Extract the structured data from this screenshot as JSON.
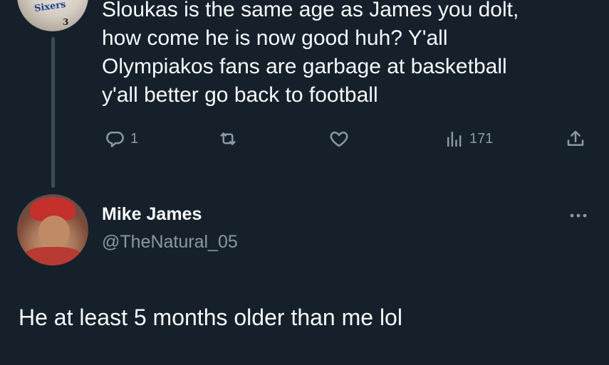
{
  "parent_tweet": {
    "avatar_icon": "user-avatar-icon",
    "avatar_jersey_text": "Sixers",
    "avatar_jersey_number": "3",
    "text_lines": [
      "Sloukas is the same age as James you dolt,",
      "how come he is now good huh? Y'all",
      "Olympiakos fans are garbage at basketball",
      "y'all better go back to football"
    ],
    "actions": {
      "reply_icon": "reply-icon",
      "reply_count": "1",
      "retweet_icon": "retweet-icon",
      "like_icon": "heart-icon",
      "views_icon": "views-icon",
      "views_count": "171",
      "share_icon": "share-icon"
    }
  },
  "reply_tweet": {
    "avatar_icon": "user-avatar-icon",
    "display_name": "Mike James",
    "handle": "@TheNatural_05",
    "more_icon": "more-icon",
    "text": "He at least 5 months older than me lol"
  },
  "colors": {
    "background": "#15202b",
    "text_primary": "#f7f9f9",
    "text_secondary": "#8b98a5",
    "thread_line": "#3a4a58"
  }
}
